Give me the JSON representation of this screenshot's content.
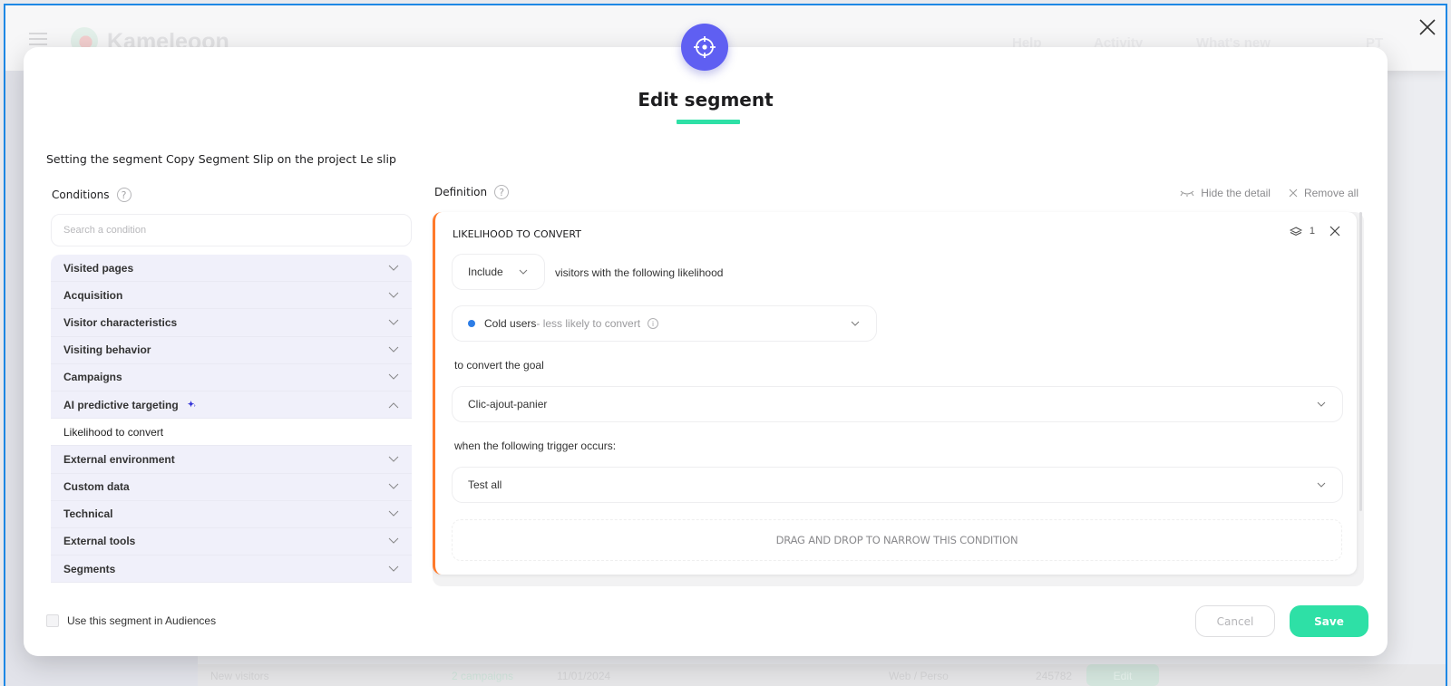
{
  "background": {
    "brand": "Kameleoon",
    "nav": [
      "Help",
      "Activity",
      "What's new"
    ],
    "user_initials": "PT",
    "row": {
      "name": "New visitors",
      "campaigns": "2 campaigns",
      "date": "11/01/2024",
      "type": "Web / Perso",
      "id": "245782",
      "action": "Edit"
    }
  },
  "modal": {
    "title": "Edit segment",
    "subtitle": "Setting the segment Copy Segment Slip on the project Le slip",
    "icon": "target-icon",
    "accent_color": "#2ee0a6",
    "icon_color": "#5f5ff2"
  },
  "conditions": {
    "label": "Conditions",
    "help": "?",
    "search_placeholder": "Search a condition",
    "items": [
      {
        "label": "Visited pages",
        "expanded": false
      },
      {
        "label": "Acquisition",
        "expanded": false
      },
      {
        "label": "Visitor characteristics",
        "expanded": false
      },
      {
        "label": "Visiting behavior",
        "expanded": false
      },
      {
        "label": "Campaigns",
        "expanded": false
      },
      {
        "label": "AI predictive targeting",
        "expanded": true,
        "badge": "sparkle-icon"
      },
      {
        "label": "Likelihood to convert",
        "sub": true
      },
      {
        "label": "External environment",
        "expanded": false
      },
      {
        "label": "Custom data",
        "expanded": false
      },
      {
        "label": "Technical",
        "expanded": false
      },
      {
        "label": "External tools",
        "expanded": false
      },
      {
        "label": "Segments",
        "expanded": false
      }
    ]
  },
  "definition": {
    "label": "Definition",
    "help": "?",
    "hide_detail": "Hide the detail",
    "remove_all": "Remove all",
    "card": {
      "title": "LIKELIHOOD TO CONVERT",
      "layer_count": "1",
      "accent_color": "#ff7a2a",
      "include_select": "Include",
      "include_text": "visitors with the following likelihood",
      "likelihood_value": "Cold users",
      "likelihood_desc": " - less likely to convert",
      "likelihood_dot_color": "#2d7de6",
      "goal_label": "to convert the goal",
      "goal_value": "Clic-ajout-panier",
      "trigger_label": "when the following trigger occurs:",
      "trigger_value": "Test all",
      "dropzone": "DRAG AND DROP TO NARROW THIS CONDITION"
    }
  },
  "footer": {
    "audiences_checkbox": "Use this segment in Audiences",
    "audiences_checked": false,
    "cancel": "Cancel",
    "save": "Save"
  }
}
